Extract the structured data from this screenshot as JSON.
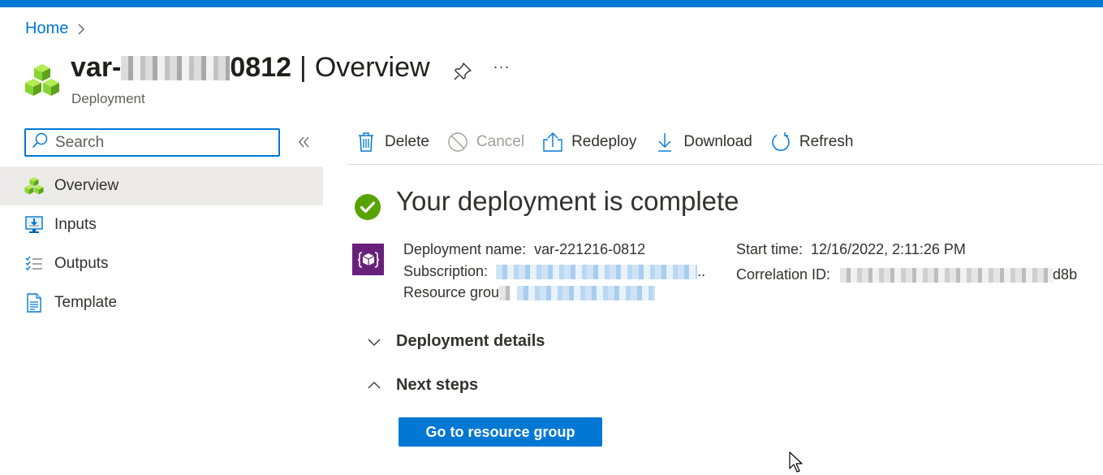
{
  "colors": {
    "accent": "#0078d4",
    "success": "#57a300",
    "deployment_icon_bg": "#68217a",
    "resource_green": "#7fba00"
  },
  "breadcrumb": {
    "items": [
      {
        "label": "Home"
      }
    ],
    "separator_icon": "chevron-right-icon"
  },
  "header": {
    "title_prefix": "var-",
    "title_redacted": true,
    "title_suffix": "0812",
    "title_separator": "|",
    "section": "Overview",
    "subtitle": "Deployment",
    "icon": "resource-group-cubes-icon",
    "pin_icon": "pin-icon",
    "more_label": "···"
  },
  "sidebar": {
    "search": {
      "placeholder": "Search",
      "value": ""
    },
    "collapse_icon": "double-chevron-left-icon",
    "items": [
      {
        "label": "Overview",
        "icon": "cubes-icon",
        "active": true
      },
      {
        "label": "Inputs",
        "icon": "monitor-download-icon",
        "active": false
      },
      {
        "label": "Outputs",
        "icon": "checklist-icon",
        "active": false
      },
      {
        "label": "Template",
        "icon": "document-icon",
        "active": false
      }
    ]
  },
  "toolbar": {
    "buttons": [
      {
        "label": "Delete",
        "icon": "trash-icon",
        "enabled": true
      },
      {
        "label": "Cancel",
        "icon": "cancel-icon",
        "enabled": false
      },
      {
        "label": "Redeploy",
        "icon": "upload-icon",
        "enabled": true
      },
      {
        "label": "Download",
        "icon": "download-icon",
        "enabled": true
      },
      {
        "label": "Refresh",
        "icon": "refresh-icon",
        "enabled": true
      }
    ]
  },
  "status": {
    "title": "Your deployment is complete",
    "icon": "check-circle-icon"
  },
  "details": {
    "deployment_name_label": "Deployment name:",
    "deployment_name": "var-221216-0812",
    "subscription_label": "Subscription:",
    "subscription_redacted": true,
    "subscription_ellipsis": "..",
    "resource_group_label": "Resource grou",
    "resource_group_redacted": true,
    "start_time_label": "Start time:",
    "start_time": "12/16/2022, 2:11:26 PM",
    "correlation_id_label": "Correlation ID:",
    "correlation_id_redacted": true,
    "correlation_id_suffix": "d8b"
  },
  "sections": [
    {
      "label": "Deployment details",
      "expanded": false
    },
    {
      "label": "Next steps",
      "expanded": true
    }
  ],
  "next_steps": {
    "primary_button": "Go to resource group"
  }
}
